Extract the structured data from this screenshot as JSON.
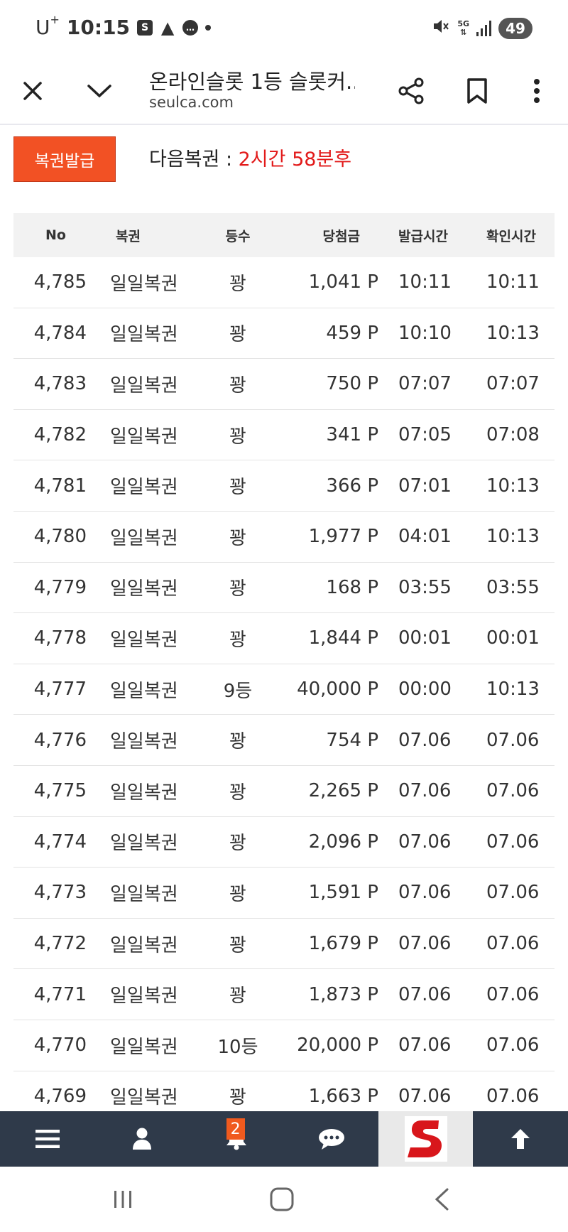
{
  "status_bar": {
    "carrier": "U",
    "carrier_sup": "+",
    "time": "10:15",
    "network": "5G",
    "battery": "49"
  },
  "browser": {
    "title": "온라인슬롯 1등 슬롯커...",
    "url": "seulca.com"
  },
  "top": {
    "issue_button": "복권발급",
    "next_label": "다음복권 : ",
    "next_value": "2시간 58분후"
  },
  "table": {
    "headers": [
      "No",
      "복권",
      "등수",
      "당첨금",
      "발급시간",
      "확인시간"
    ],
    "rows": [
      [
        "4,785",
        "일일복권",
        "꽝",
        "1,041 P",
        "10:11",
        "10:11"
      ],
      [
        "4,784",
        "일일복권",
        "꽝",
        "459 P",
        "10:10",
        "10:13"
      ],
      [
        "4,783",
        "일일복권",
        "꽝",
        "750 P",
        "07:07",
        "07:07"
      ],
      [
        "4,782",
        "일일복권",
        "꽝",
        "341 P",
        "07:05",
        "07:08"
      ],
      [
        "4,781",
        "일일복권",
        "꽝",
        "366 P",
        "07:01",
        "10:13"
      ],
      [
        "4,780",
        "일일복권",
        "꽝",
        "1,977 P",
        "04:01",
        "10:13"
      ],
      [
        "4,779",
        "일일복권",
        "꽝",
        "168 P",
        "03:55",
        "03:55"
      ],
      [
        "4,778",
        "일일복권",
        "꽝",
        "1,844 P",
        "00:01",
        "00:01"
      ],
      [
        "4,777",
        "일일복권",
        "9등",
        "40,000 P",
        "00:00",
        "10:13"
      ],
      [
        "4,776",
        "일일복권",
        "꽝",
        "754 P",
        "07.06",
        "07.06"
      ],
      [
        "4,775",
        "일일복권",
        "꽝",
        "2,265 P",
        "07.06",
        "07.06"
      ],
      [
        "4,774",
        "일일복권",
        "꽝",
        "2,096 P",
        "07.06",
        "07.06"
      ],
      [
        "4,773",
        "일일복권",
        "꽝",
        "1,591 P",
        "07.06",
        "07.06"
      ],
      [
        "4,772",
        "일일복권",
        "꽝",
        "1,679 P",
        "07.06",
        "07.06"
      ],
      [
        "4,771",
        "일일복권",
        "꽝",
        "1,873 P",
        "07.06",
        "07.06"
      ],
      [
        "4,770",
        "일일복권",
        "10등",
        "20,000 P",
        "07.06",
        "07.06"
      ],
      [
        "4,769",
        "일일복권",
        "꽝",
        "1,663 P",
        "07.06",
        "07.06"
      ]
    ]
  },
  "bottom_nav": {
    "notification_count": "2",
    "icons": [
      "menu-icon",
      "user-icon",
      "bell-icon",
      "chat-icon",
      "site-logo",
      "arrow-up-icon"
    ]
  },
  "colors": {
    "accent": "#f25124",
    "highlight_text": "#e21a1a",
    "nav_bg": "#2f3a4a"
  }
}
